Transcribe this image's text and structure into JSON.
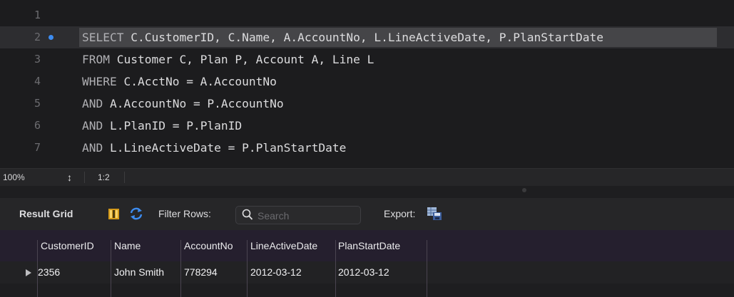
{
  "editor": {
    "lines": [
      {
        "num": "1",
        "text": ""
      },
      {
        "num": "2",
        "kw": "SELECT",
        "rest": " C.CustomerID, C.Name, A.AccountNo, L.LineActiveDate, P.PlanStartDate"
      },
      {
        "num": "3",
        "kw": "FROM",
        "rest": " Customer C, Plan P, Account A, Line L"
      },
      {
        "num": "4",
        "kw": "WHERE",
        "rest": " C.AcctNo = A.AccountNo"
      },
      {
        "num": "5",
        "kw": "AND",
        "rest": " A.AccountNo = P.AccountNo"
      },
      {
        "num": "6",
        "kw": "AND",
        "rest": " L.PlanID = P.PlanID"
      },
      {
        "num": "7",
        "kw": "AND",
        "rest": " L.LineActiveDate = P.PlanStartDate"
      }
    ]
  },
  "status": {
    "zoom": "100%",
    "stepper": "↕",
    "cursor": "1:2"
  },
  "toolbar": {
    "result_grid": "Result Grid",
    "filter_rows": "Filter Rows:",
    "search_placeholder": "Search",
    "export": "Export:"
  },
  "grid": {
    "columns": [
      "CustomerID",
      "Name",
      "AccountNo",
      "LineActiveDate",
      "PlanStartDate"
    ],
    "rows": [
      [
        "2356",
        "John Smith",
        "778294",
        "2012-03-12",
        "2012-03-12"
      ]
    ]
  },
  "colors": {
    "accent": "#3d8cf0",
    "header_bg": "#251f2e",
    "editor_bg": "#1c1c1e"
  }
}
